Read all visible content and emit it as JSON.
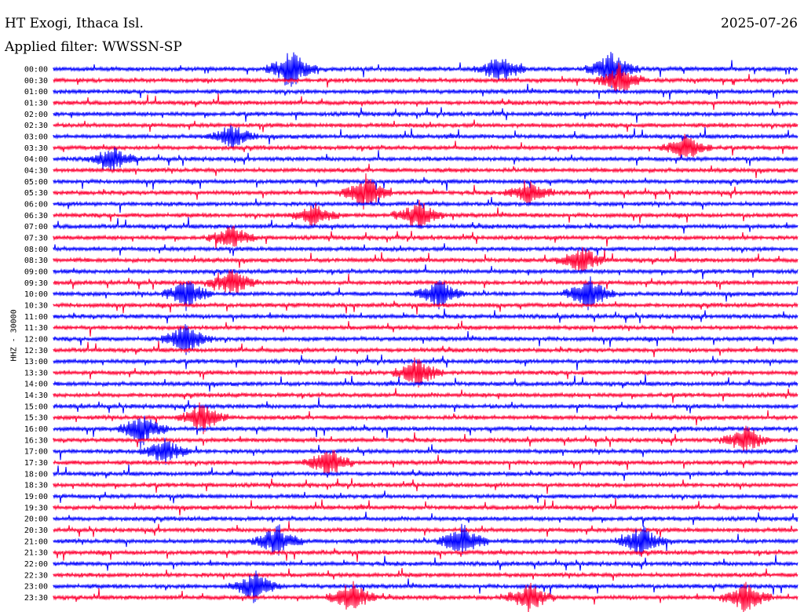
{
  "header": {
    "title": "HT Exogi, Ithaca Isl.",
    "date": "2025-07-26",
    "filter": "Applied filter: WWSSN-SP"
  },
  "chart_data": {
    "type": "line",
    "ylabel": "HHZ - 30000",
    "colors": [
      "#0000ff",
      "#ff0033"
    ],
    "rows": [
      "00:00",
      "00:30",
      "01:00",
      "01:30",
      "02:00",
      "02:30",
      "03:00",
      "03:30",
      "04:00",
      "04:30",
      "05:00",
      "05:30",
      "06:00",
      "06:30",
      "07:00",
      "07:30",
      "08:00",
      "08:30",
      "09:00",
      "09:30",
      "10:00",
      "10:30",
      "11:00",
      "11:30",
      "12:00",
      "12:30",
      "13:00",
      "13:30",
      "14:00",
      "14:30",
      "15:00",
      "15:30",
      "16:00",
      "16:30",
      "17:00",
      "17:30",
      "18:00",
      "18:30",
      "19:00",
      "19:30",
      "20:00",
      "20:30",
      "21:00",
      "21:30",
      "22:00",
      "22:30",
      "23:00",
      "23:30"
    ],
    "events": [
      {
        "row": 0,
        "x": 0.32,
        "amp": 1.0
      },
      {
        "row": 0,
        "x": 0.6,
        "amp": 0.7
      },
      {
        "row": 0,
        "x": 0.75,
        "amp": 0.9
      },
      {
        "row": 1,
        "x": 0.76,
        "amp": 0.8
      },
      {
        "row": 6,
        "x": 0.24,
        "amp": 0.6
      },
      {
        "row": 7,
        "x": 0.85,
        "amp": 0.7
      },
      {
        "row": 8,
        "x": 0.08,
        "amp": 0.6
      },
      {
        "row": 11,
        "x": 0.42,
        "amp": 0.9
      },
      {
        "row": 11,
        "x": 0.64,
        "amp": 0.6
      },
      {
        "row": 13,
        "x": 0.35,
        "amp": 0.6
      },
      {
        "row": 13,
        "x": 0.49,
        "amp": 0.8
      },
      {
        "row": 15,
        "x": 0.24,
        "amp": 0.6
      },
      {
        "row": 17,
        "x": 0.71,
        "amp": 0.7
      },
      {
        "row": 19,
        "x": 0.24,
        "amp": 0.7
      },
      {
        "row": 20,
        "x": 0.18,
        "amp": 0.8
      },
      {
        "row": 20,
        "x": 0.52,
        "amp": 0.8
      },
      {
        "row": 20,
        "x": 0.72,
        "amp": 0.9
      },
      {
        "row": 24,
        "x": 0.18,
        "amp": 0.9
      },
      {
        "row": 27,
        "x": 0.49,
        "amp": 0.8
      },
      {
        "row": 31,
        "x": 0.2,
        "amp": 0.8
      },
      {
        "row": 32,
        "x": 0.12,
        "amp": 0.8
      },
      {
        "row": 33,
        "x": 0.93,
        "amp": 0.7
      },
      {
        "row": 34,
        "x": 0.15,
        "amp": 0.7
      },
      {
        "row": 35,
        "x": 0.37,
        "amp": 0.8
      },
      {
        "row": 42,
        "x": 0.3,
        "amp": 0.8
      },
      {
        "row": 42,
        "x": 0.55,
        "amp": 0.9
      },
      {
        "row": 42,
        "x": 0.79,
        "amp": 0.8
      },
      {
        "row": 46,
        "x": 0.27,
        "amp": 0.8
      },
      {
        "row": 47,
        "x": 0.4,
        "amp": 0.9
      },
      {
        "row": 47,
        "x": 0.64,
        "amp": 0.8
      },
      {
        "row": 47,
        "x": 0.93,
        "amp": 0.8
      }
    ]
  }
}
